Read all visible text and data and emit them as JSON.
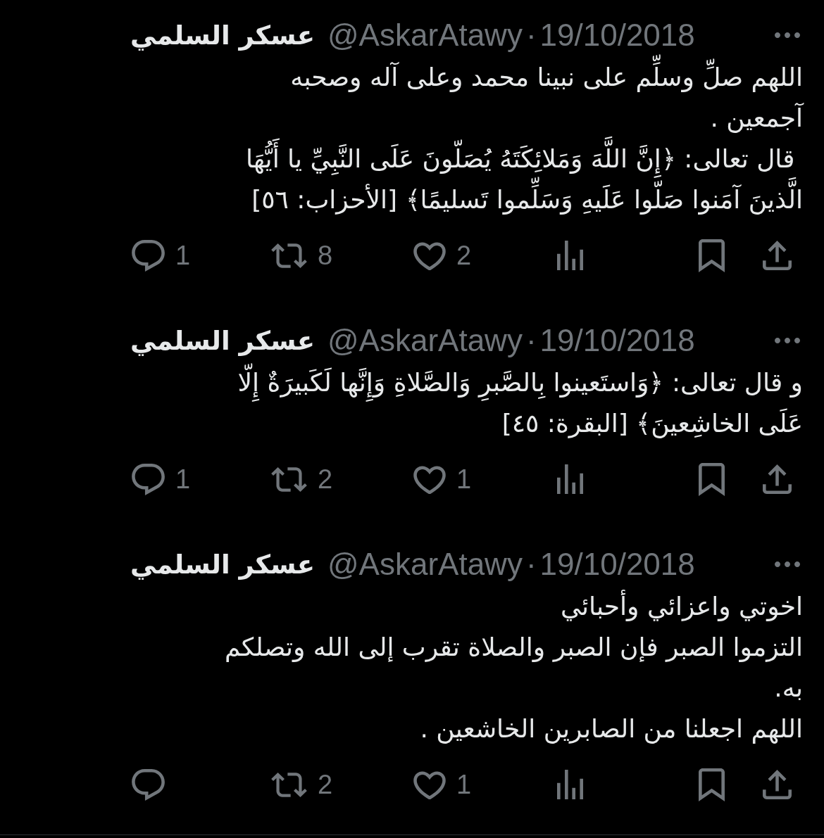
{
  "tweets": [
    {
      "author": {
        "name": "عسكر السلمي",
        "handle": "@AskarAtawy"
      },
      "separator": "·",
      "date": "19/10/2018",
      "text": "اللهم صلِّ وسلِّم على نبينا محمد وعلى آله وصحبه\nآجمعين .\n قال تعالى: ﴿إِنَّ اللَّهَ وَمَلائِكَتَهُ يُصَلّونَ عَلَى النَّبِيِّ يا أَيُّهَا\nالَّذينَ آمَنوا صَلّوا عَلَيهِ وَسَلِّموا تَسليمًا﴾ [الأحزاب: ٥٦]",
      "actions": {
        "replies": "1",
        "reposts": "8",
        "likes": "2"
      }
    },
    {
      "author": {
        "name": "عسكر السلمي",
        "handle": "@AskarAtawy"
      },
      "separator": "·",
      "date": "19/10/2018",
      "text": "و قال تعالى: ﴿وَاستَعينوا بِالصَّبرِ وَالصَّلاةِ وَإِنَّها لَكَبيرَةٌ إِلّا\nعَلَى الخاشِعينَ﴾ [البقرة: ٤٥]",
      "actions": {
        "replies": "1",
        "reposts": "2",
        "likes": "1"
      }
    },
    {
      "author": {
        "name": "عسكر السلمي",
        "handle": "@AskarAtawy"
      },
      "separator": "·",
      "date": "19/10/2018",
      "text": "اخوتي واعزائي وأحبائي\nالتزموا الصبر فإن الصبر والصلاة تقرب إلى الله وتصلكم\nبه.\nاللهم اجعلنا من الصابرين الخاشعين .",
      "actions": {
        "reposts": "2",
        "likes": "1"
      }
    }
  ]
}
